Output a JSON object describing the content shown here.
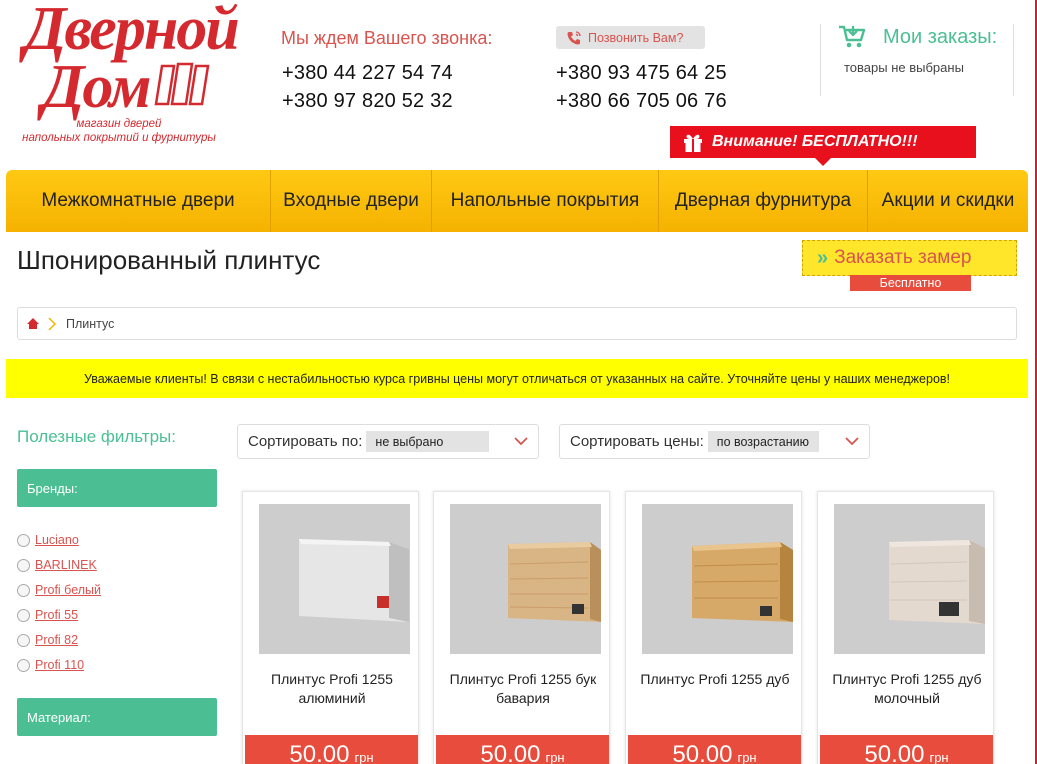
{
  "logo": {
    "line1": "Дверной",
    "line2": "Дом",
    "subtitle_1": "магазин дверей",
    "subtitle_2": "напольных покрытий и фурнитуры"
  },
  "header": {
    "call_wait": "Мы ждем Вашего звонка:",
    "phones_left": [
      "+380 44 227 54 74",
      "+380 97 820 52 32"
    ],
    "phones_right": [
      "+380 93 475 64 25",
      "+380 66 705 06 76"
    ],
    "call_button": "Позвонить Вам?",
    "orders_title": "Мои заказы:",
    "orders_subtitle": "товары не выбраны",
    "promo": "Внимание! БЕСПЛАТНО!!!"
  },
  "nav": {
    "items": [
      "Межкомнатные двери",
      "Входные двери",
      "Напольные покрытия",
      "Дверная фурнитура",
      "Акции и скидки"
    ]
  },
  "page": {
    "title": "Шпонированный плинтус",
    "measure_button": "Заказать замер",
    "measure_free": "Бесплатно",
    "breadcrumb_current": "Плинтус",
    "notice": "Уважаемые клиенты! В связи с нестабильностью курса гривны цены могут отличаться от указанных на сайте. Уточняйте цены у наших менеджеров!"
  },
  "sidebar": {
    "title": "Полезные фильтры:",
    "brands_header": "Бренды:",
    "brands": [
      "Luciano",
      "BARLINEK",
      "Profi белый",
      "Profi 55",
      "Profi 82",
      "Profi 110"
    ],
    "material_header": "Материал:"
  },
  "sort": {
    "label": "Сортировать по:",
    "value": "не выбрано",
    "price_label": "Сортировать цены:",
    "price_value": "по возрастанию"
  },
  "products": [
    {
      "name": "Плинтус Profi 1255 алюминий",
      "price": "50.00",
      "currency": "грн"
    },
    {
      "name": "Плинтус Profi 1255 бук бавария",
      "price": "50.00",
      "currency": "грн"
    },
    {
      "name": "Плинтус Profi 1255 дуб",
      "price": "50.00",
      "currency": "грн"
    },
    {
      "name": "Плинтус Profi 1255 дуб молочный",
      "price": "50.00",
      "currency": "грн"
    }
  ],
  "colors": {
    "brand_red": "#d42a2f",
    "accent_green": "#4bbf93",
    "nav_yellow": "#ffc913",
    "price_red": "#e74c3c"
  }
}
